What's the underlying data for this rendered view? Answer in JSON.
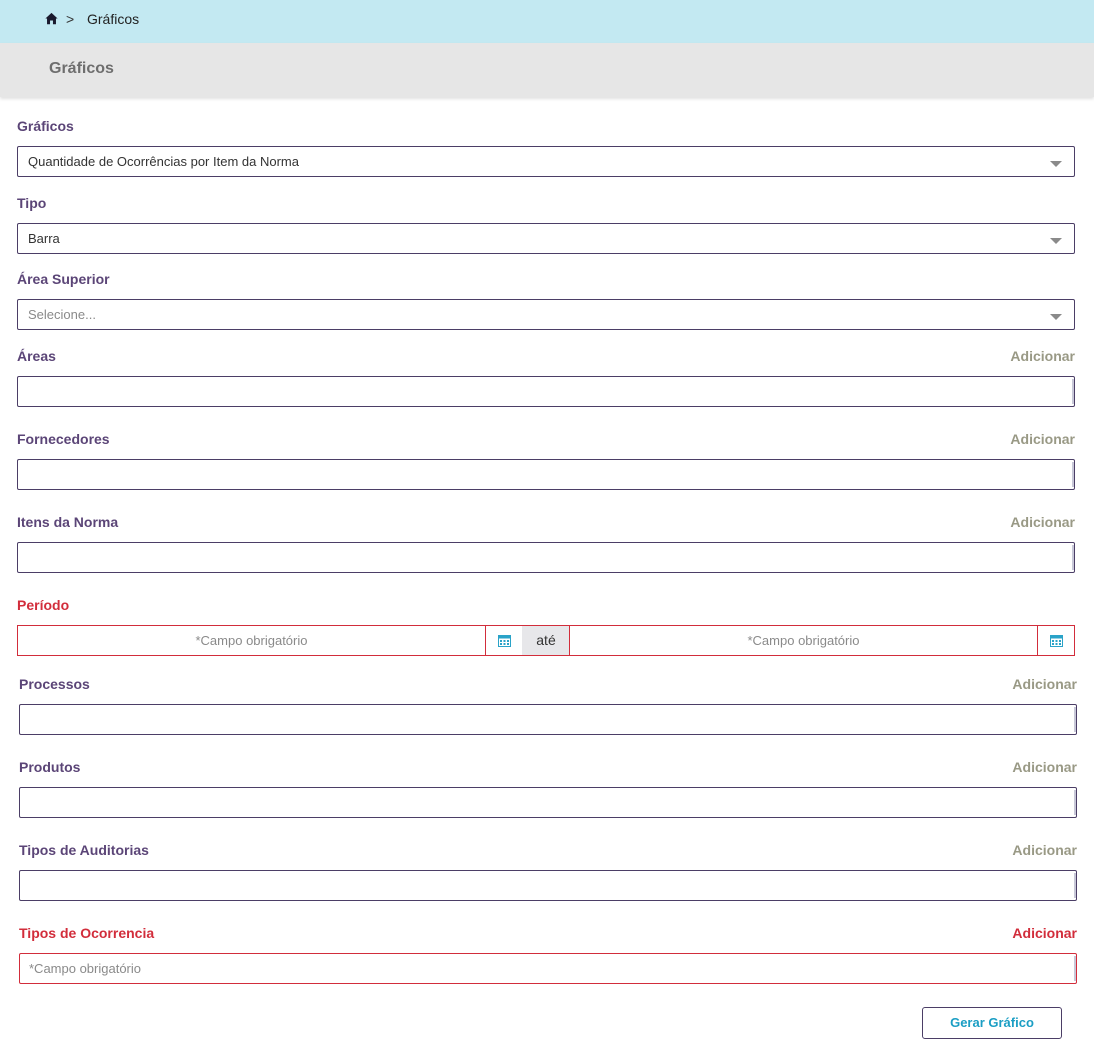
{
  "breadcrumb": {
    "home_icon": "home-icon",
    "separator": ">",
    "current": "Gráficos"
  },
  "header": {
    "title": "Gráficos"
  },
  "form": {
    "graficos": {
      "label": "Gráficos",
      "value": "Quantidade de Ocorrências por Item da Norma"
    },
    "tipo": {
      "label": "Tipo",
      "value": "Barra"
    },
    "area_superior": {
      "label": "Área Superior",
      "placeholder": "Selecione..."
    },
    "areas": {
      "label": "Áreas",
      "add": "Adicionar"
    },
    "fornecedores": {
      "label": "Fornecedores",
      "add": "Adicionar"
    },
    "itens_norma": {
      "label": "Itens da Norma",
      "add": "Adicionar"
    },
    "periodo": {
      "label": "Período",
      "start_placeholder": "*Campo obrigatório",
      "separator": "até",
      "end_placeholder": "*Campo obrigatório",
      "calendar_icon": "calendar-icon"
    },
    "processos": {
      "label": "Processos",
      "add": "Adicionar"
    },
    "produtos": {
      "label": "Produtos",
      "add": "Adicionar"
    },
    "tipos_auditorias": {
      "label": "Tipos de Auditorias",
      "add": "Adicionar"
    },
    "tipos_ocorrencia": {
      "label": "Tipos de Ocorrencia",
      "add": "Adicionar",
      "placeholder": "*Campo obrigatório"
    }
  },
  "actions": {
    "generate_label": "Gerar Gráfico"
  },
  "colors": {
    "label": "#5b4577",
    "required": "#d22d3b",
    "accent": "#1b9ec4",
    "breadcrumb_bg": "#c3e9f2"
  }
}
